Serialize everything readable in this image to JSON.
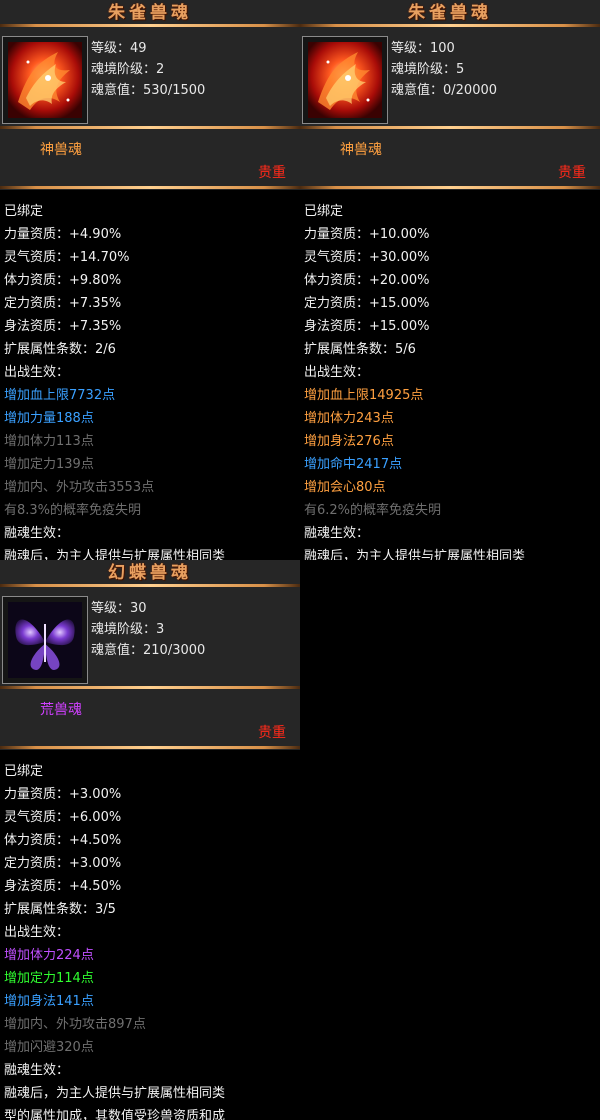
{
  "cards": [
    {
      "title": "朱雀兽魂",
      "level": "等级：49",
      "realm": "魂境阶级：2",
      "will": "魂意值：530/1500",
      "soul_type": "神兽魂",
      "soul_type_color": "#ffa040",
      "rarity": "贵重",
      "bound": "已绑定",
      "stats": [
        "力量资质：+4.90%",
        "灵气资质：+14.70%",
        "体力资质：+9.80%",
        "定力资质：+7.35%",
        "身法资质：+7.35%"
      ],
      "ext_count": "扩展属性条数：2/6",
      "battle_label": "出战生效：",
      "effects": [
        {
          "text": "增加血上限7732点",
          "color": "blue"
        },
        {
          "text": "增加力量188点",
          "color": "blue"
        },
        {
          "text": "增加体力113点",
          "color": "gray"
        },
        {
          "text": "增加定力139点",
          "color": "gray"
        },
        {
          "text": "增加内、外功攻击3553点",
          "color": "gray"
        },
        {
          "text": "有8.3%的概率免疫失明",
          "color": "gray"
        }
      ],
      "fusion_label": "融魂生效：",
      "fusion_desc": [
        "融魂后，为主人提供与扩展属性相同类"
      ]
    },
    {
      "title": "朱雀兽魂",
      "level": "等级：100",
      "realm": "魂境阶级：5",
      "will": "魂意值：0/20000",
      "soul_type": "神兽魂",
      "soul_type_color": "#ffa040",
      "rarity": "贵重",
      "bound": "已绑定",
      "stats": [
        "力量资质：+10.00%",
        "灵气资质：+30.00%",
        "体力资质：+20.00%",
        "定力资质：+15.00%",
        "身法资质：+15.00%"
      ],
      "ext_count": "扩展属性条数：5/6",
      "battle_label": "出战生效：",
      "effects": [
        {
          "text": "增加血上限14925点",
          "color": "orange"
        },
        {
          "text": "增加体力243点",
          "color": "orange"
        },
        {
          "text": "增加身法276点",
          "color": "orange"
        },
        {
          "text": "增加命中2417点",
          "color": "blue"
        },
        {
          "text": "增加会心80点",
          "color": "orange"
        },
        {
          "text": "有6.2%的概率免疫失明",
          "color": "gray"
        }
      ],
      "fusion_label": "融魂生效：",
      "fusion_desc": [
        "融魂后，为主人提供与扩展属性相同类"
      ]
    },
    {
      "title": "幻蝶兽魂",
      "level": "等级：30",
      "realm": "魂境阶级：3",
      "will": "魂意值：210/3000",
      "soul_type": "荒兽魂",
      "soul_type_color": "#d040ff",
      "rarity": "贵重",
      "bound": "已绑定",
      "stats": [
        "力量资质：+3.00%",
        "灵气资质：+6.00%",
        "体力资质：+4.50%",
        "定力资质：+3.00%",
        "身法资质：+4.50%"
      ],
      "ext_count": "扩展属性条数：3/5",
      "battle_label": "出战生效：",
      "effects": [
        {
          "text": "增加体力224点",
          "color": "purple"
        },
        {
          "text": "增加定力114点",
          "color": "green"
        },
        {
          "text": "增加身法141点",
          "color": "blue"
        },
        {
          "text": "增加内、外功攻击897点",
          "color": "gray"
        },
        {
          "text": "增加闪避320点",
          "color": "gray"
        }
      ],
      "fusion_label": "融魂生效：",
      "fusion_desc": [
        "融魂后，为主人提供与扩展属性相同类",
        "型的属性加成，其数值受珍兽资质和成"
      ]
    }
  ]
}
